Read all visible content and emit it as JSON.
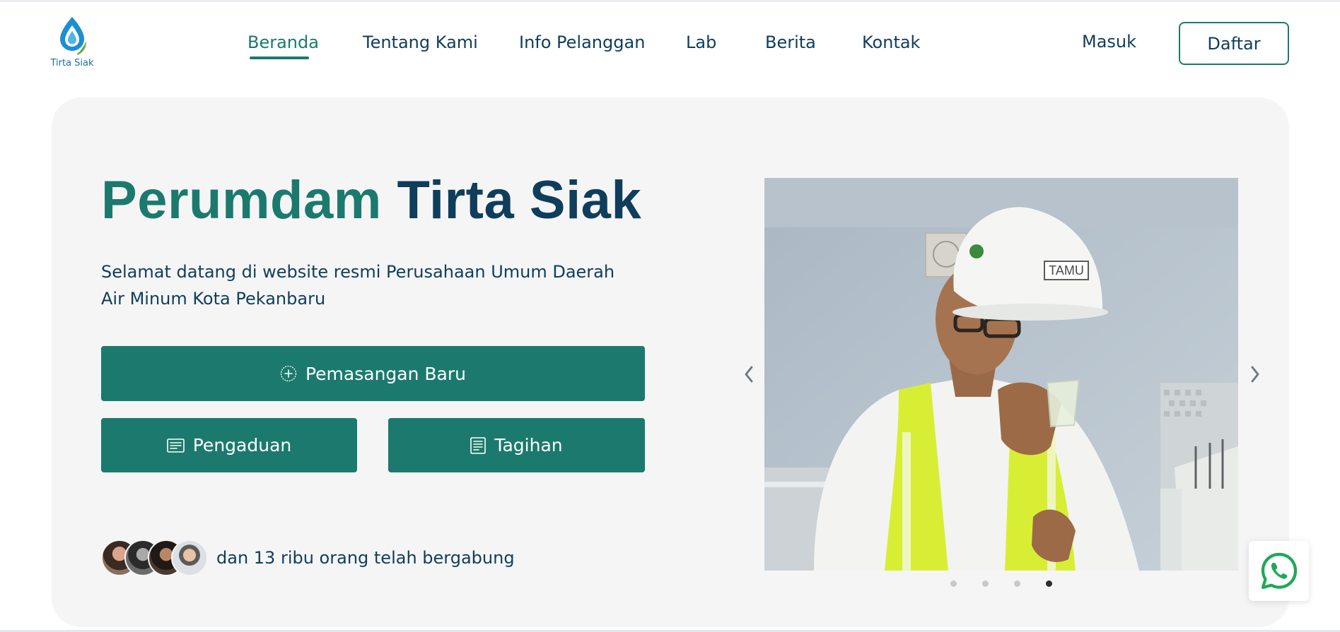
{
  "brand": {
    "logo_text": "Tirta Siak"
  },
  "nav": {
    "items": [
      {
        "label": "Beranda",
        "active": true
      },
      {
        "label": "Tentang Kami",
        "active": false
      },
      {
        "label": "Info Pelanggan",
        "active": false
      },
      {
        "label": "Lab",
        "active": false
      },
      {
        "label": "Berita",
        "active": false
      },
      {
        "label": "Kontak",
        "active": false
      }
    ],
    "login_label": "Masuk",
    "register_label": "Daftar"
  },
  "hero": {
    "title_part1": "Perumdam",
    "title_part2": "Tirta Siak",
    "subtitle": "Selamat datang di website resmi Perusahaan Umum Daerah Air Minum Kota Pekanbaru",
    "primary_button": {
      "label": "Pemasangan Baru",
      "icon": "plus-circle-icon"
    },
    "complaint_button": {
      "label": "Pengaduan",
      "icon": "message-lines-icon"
    },
    "bill_button": {
      "label": "Tagihan",
      "icon": "receipt-icon"
    },
    "joined_text": "dan 13 ribu orang telah bergabung"
  },
  "carousel": {
    "slide_count": 4,
    "active_slide": 4,
    "helmet_text": "TAMU",
    "prev_icon": "chevron-left-icon",
    "next_icon": "chevron-right-icon"
  },
  "floating": {
    "icon": "whatsapp-icon"
  },
  "colors": {
    "accent_green": "#1b7a6d",
    "navy": "#0f3d5c",
    "card_bg": "#f5f5f6",
    "whatsapp_green": "#1fa855"
  }
}
